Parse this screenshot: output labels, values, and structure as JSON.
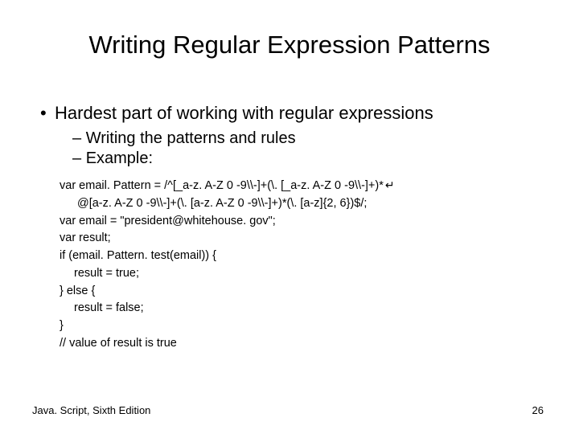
{
  "title": "Writing Regular Expression Patterns",
  "bullet1": "Hardest part of working with regular expressions",
  "sub1": "Writing the patterns and rules",
  "sub2": "Example:",
  "code": {
    "l1a": "var email. Pattern = /^[_a-z. A-Z 0 -9\\\\-]+(\\. [_a-z. A-Z 0 -9\\\\-]+)*",
    "l1b": "@[a-z. A-Z 0 -9\\\\-]+(\\. [a-z. A-Z 0 -9\\\\-]+)*(\\. [a-z]{2, 6})$/;",
    "l2": "var email = \"president@whitehouse. gov\";",
    "l3": "var result;",
    "l4": "if (email. Pattern. test(email)) {",
    "l5": "result = true;",
    "l6": "} else {",
    "l7": "result = false;",
    "l8": "}",
    "l9": "// value of result is true"
  },
  "footer": {
    "left": "Java. Script, Sixth Edition",
    "right": "26"
  }
}
